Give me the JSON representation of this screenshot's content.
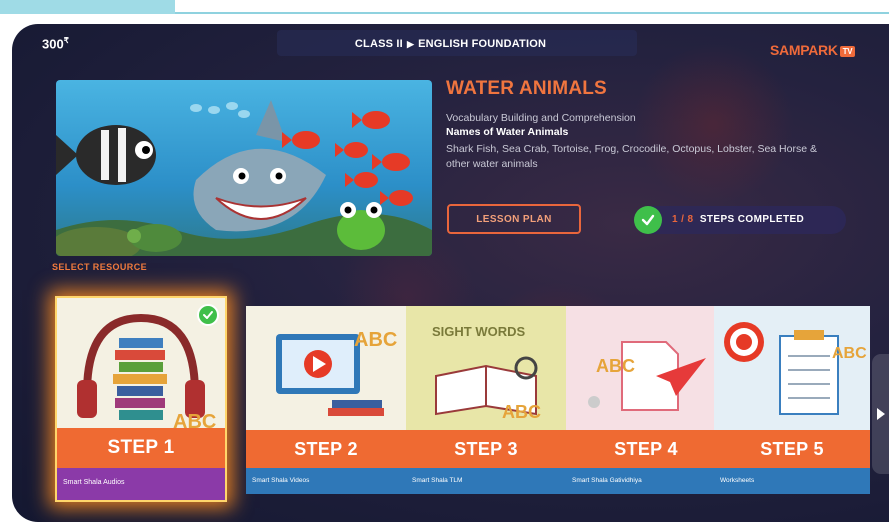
{
  "header": {
    "points": "300",
    "points_suffix": "₹",
    "breadcrumb_class": "CLASS II",
    "breadcrumb_subject": "ENGLISH FOUNDATION",
    "logo_text": "SAMPARK",
    "logo_badge": "TV"
  },
  "lesson": {
    "title": "WATER ANIMALS",
    "subtitle": "Vocabulary Building and Comprehension",
    "topic": "Names of Water Animals",
    "description": "Shark Fish, Sea Crab, Tortoise, Frog, Crocodile, Octopus, Lobster, Sea Horse & other water animals",
    "lesson_plan_label": "LESSON PLAN",
    "steps_done": "1 / 8",
    "steps_label": "STEPS COMPLETED"
  },
  "resources": {
    "label": "SELECT RESOURCE",
    "items": [
      {
        "step": "STEP 1",
        "name": "Smart Shala Audios",
        "color": "#8b3aa8",
        "completed": true
      },
      {
        "step": "STEP 2",
        "name": "Smart Shala Videos",
        "color": "#2f78b8",
        "completed": false
      },
      {
        "step": "STEP 3",
        "name": "Smart Shala TLM",
        "color": "#2f78b8",
        "completed": false
      },
      {
        "step": "STEP 4",
        "name": "Smart Shala Gatividhiya",
        "color": "#2f78b8",
        "completed": false
      },
      {
        "step": "STEP 5",
        "name": "Worksheets",
        "color": "#2f78b8",
        "completed": false
      }
    ]
  },
  "colors": {
    "accent": "#ef6a32",
    "success": "#3fbf4a",
    "background": "#1d1f3c"
  }
}
